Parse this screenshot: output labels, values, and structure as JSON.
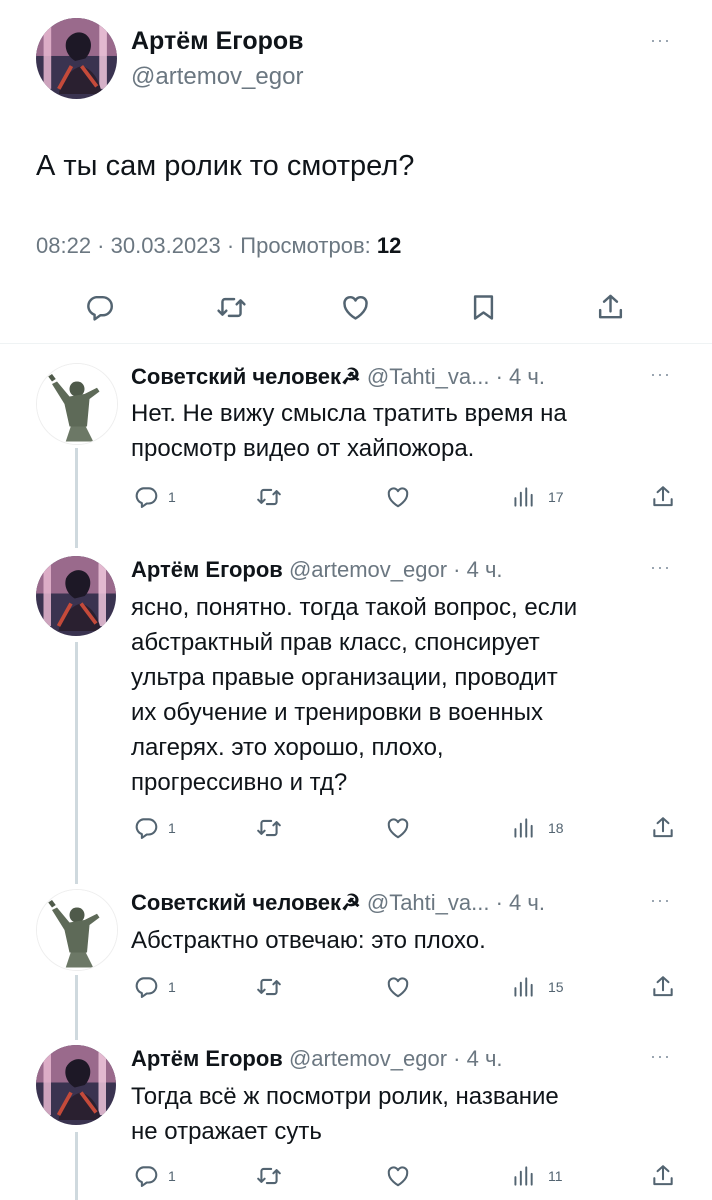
{
  "main_tweet": {
    "author_name": "Артём Егоров",
    "handle": "@artemov_egor",
    "text": "А ты сам ролик то смотрел?",
    "time_date": "08:22 · 30.03.2023 · ",
    "views_label": "Просмотров: ",
    "views_count": "12"
  },
  "replies": [
    {
      "author_name": "Советский человек☭",
      "handle": "@Tahti_va...",
      "time": "· 4 ч.",
      "text_lines": [
        "Нет. Не вижу смысла тратить время на",
        "просмотр видео от хайпожора."
      ],
      "reply_count": "1",
      "views": "17",
      "avatar": "soldier-statue"
    },
    {
      "author_name": "Артём Егоров",
      "handle": "@artemov_egor",
      "time": "· 4 ч.",
      "text_lines": [
        "ясно, понятно. тогда такой вопрос, если",
        "абстрактный прав класс, спонсирует",
        "ультра правые организации, проводит",
        "их обучение и тренировки в военных",
        "лагерях. это хорошо, плохо,",
        "прогрессивно и тд?"
      ],
      "reply_count": "1",
      "views": "18",
      "avatar": "artem"
    },
    {
      "author_name": "Советский человек☭",
      "handle": "@Tahti_va...",
      "time": "· 4 ч.",
      "text_lines": [
        "Абстрактно отвечаю: это плохо."
      ],
      "reply_count": "1",
      "views": "15",
      "avatar": "soldier-statue"
    },
    {
      "author_name": "Артём Егоров",
      "handle": "@artemov_egor",
      "time": "· 4 ч.",
      "text_lines": [
        "Тогда всё ж посмотри ролик, название",
        "не отражает суть"
      ],
      "reply_count": "1",
      "views": "11",
      "avatar": "artem"
    }
  ],
  "icons": {
    "more": "···",
    "reply": "reply-icon",
    "retweet": "retweet-icon",
    "like": "like-icon",
    "bookmark": "bookmark-icon",
    "share": "share-icon",
    "views": "views-icon"
  },
  "colors": {
    "text": "#0f1419",
    "secondary": "#6b7781",
    "divider": "#eff3f4",
    "thread": "#cfd9de"
  }
}
